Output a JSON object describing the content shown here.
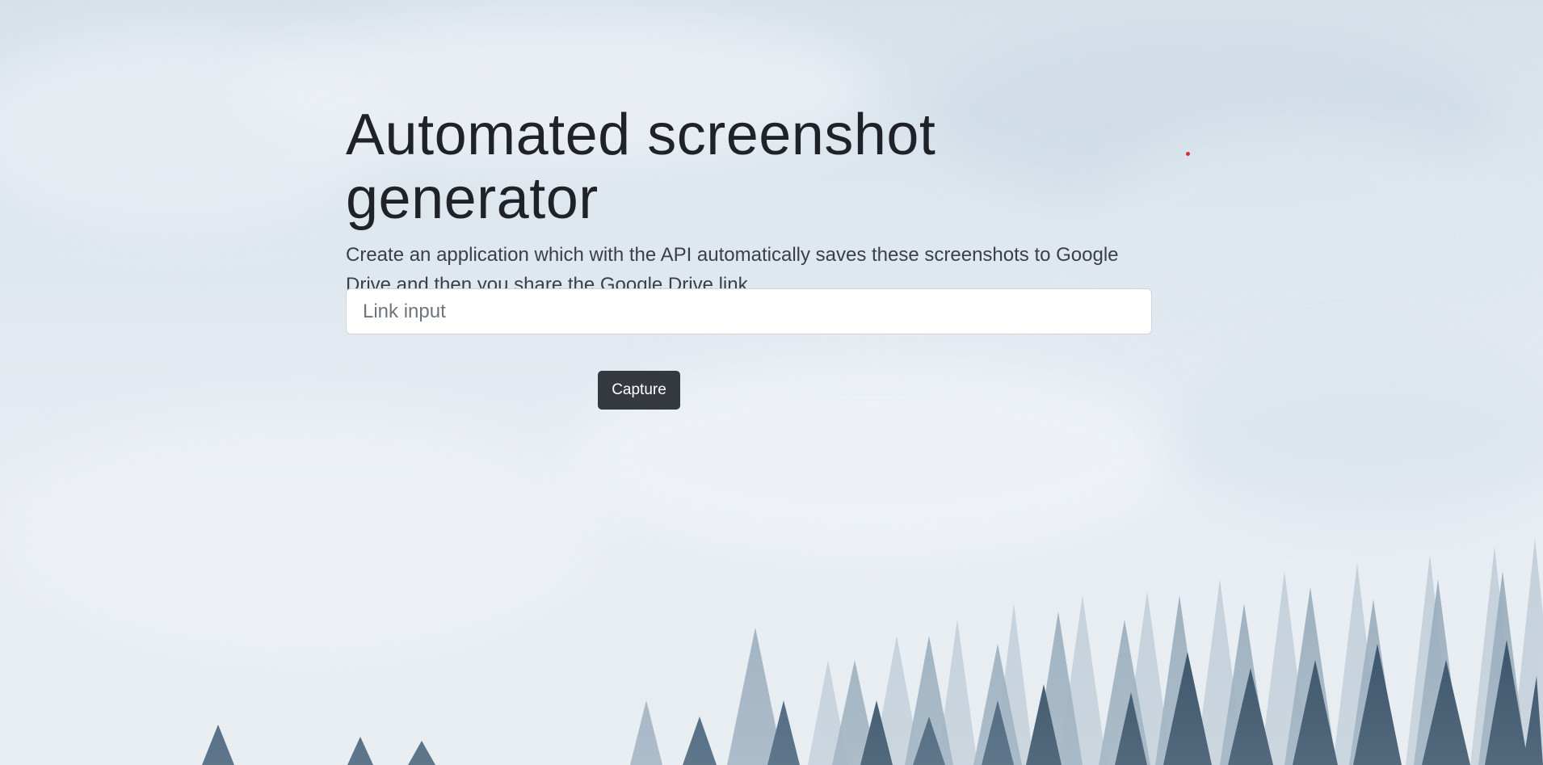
{
  "hero": {
    "title": "Automated screenshot generator",
    "description": "Create an application which with the API automatically saves these screenshots to Google Drive and then you share the Google Drive link."
  },
  "form": {
    "link_input": {
      "placeholder": "Link input",
      "value": ""
    },
    "capture_label": "Capture"
  },
  "colors": {
    "button_bg": "#343a40",
    "title_text": "#1f2327",
    "dot_accent": "#d32f2f"
  },
  "background": {
    "scene": "misty-forest-icon"
  }
}
